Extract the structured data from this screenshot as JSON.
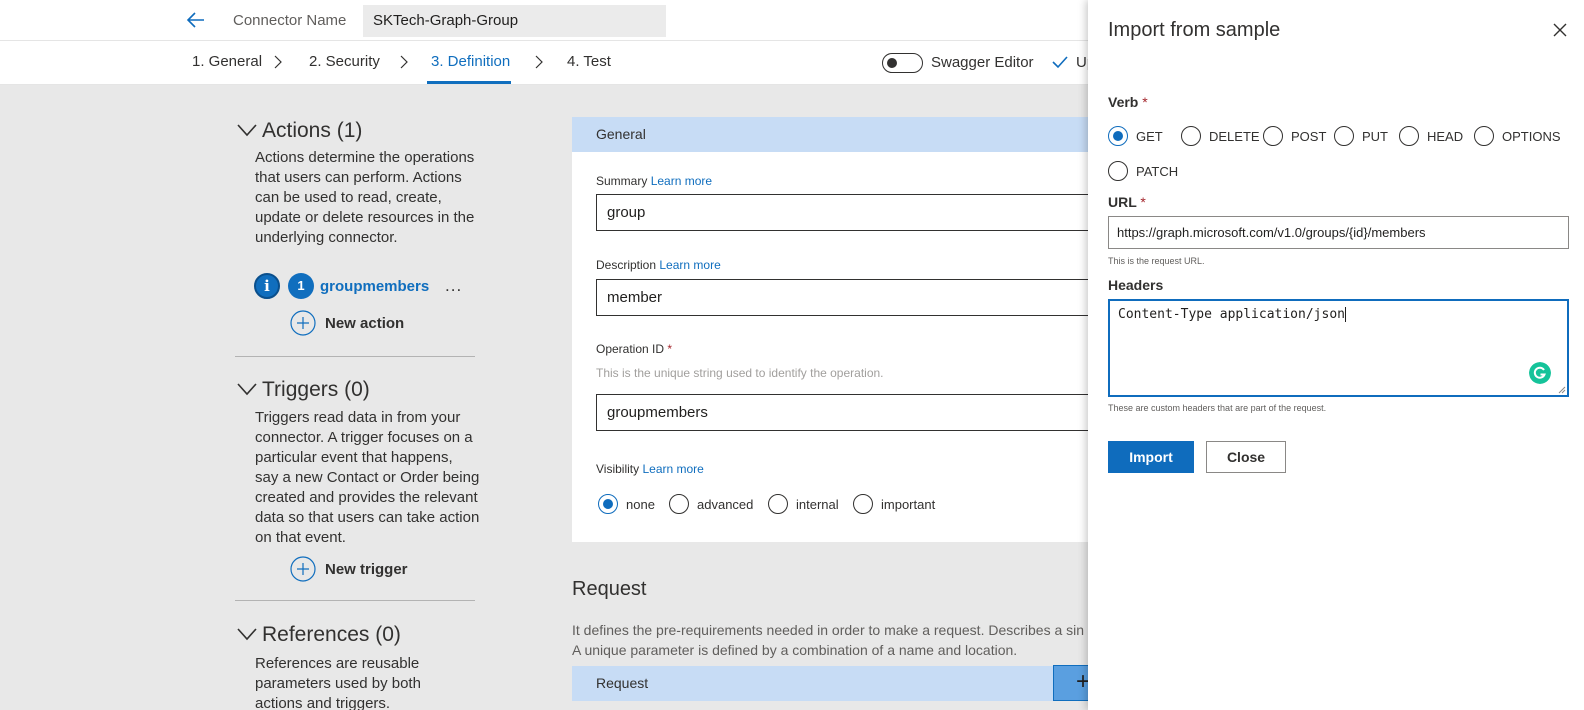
{
  "header": {
    "connector_label": "Connector Name",
    "connector_value": "SKTech-Graph-Group"
  },
  "steps": [
    {
      "label": "1. General"
    },
    {
      "label": "2. Security"
    },
    {
      "label": "3. Definition",
      "active": true
    },
    {
      "label": "4. Test"
    }
  ],
  "toolbar": {
    "swagger_label": "Swagger Editor",
    "swagger_on": false,
    "update_label": "Up"
  },
  "sidebar": {
    "actions": {
      "title": "Actions (1)",
      "desc": "Actions determine the operations that users can perform. Actions can be used to read, create, update or delete resources in the underlying connector.",
      "badge": "1",
      "item": "groupmembers",
      "more": "...",
      "new_label": "New action"
    },
    "triggers": {
      "title": "Triggers (0)",
      "desc": "Triggers read data in from your connector. A trigger focuses on a particular event that happens, say a new Contact or Order being created and provides the relevant data so that users can take action on that event.",
      "new_label": "New trigger"
    },
    "references": {
      "title": "References (0)",
      "desc": "References are reusable parameters used by both actions and triggers."
    }
  },
  "general_card": {
    "title": "General",
    "summary_label": "Summary",
    "summary_link": "Learn more",
    "summary_value": "group",
    "description_label": "Description",
    "description_link": "Learn more",
    "description_value": "member",
    "opid_label": "Operation ID",
    "opid_req": "*",
    "opid_hint": "This is the unique string used to identify the operation.",
    "opid_value": "groupmembers",
    "visibility_label": "Visibility",
    "visibility_link": "Learn more",
    "visibility_options": [
      "none",
      "advanced",
      "internal",
      "important"
    ],
    "visibility_selected": "none"
  },
  "request": {
    "title": "Request",
    "desc1": "It defines the pre-requirements needed in order to make a request. Describes a sin",
    "desc2": "A unique parameter is defined by a combination of a name and location.",
    "card_title": "Request",
    "add_symbol": "+"
  },
  "panel": {
    "title": "Import from sample",
    "verb_label": "Verb",
    "req": "*",
    "verbs": [
      "GET",
      "DELETE",
      "POST",
      "PUT",
      "HEAD",
      "OPTIONS",
      "PATCH"
    ],
    "verb_selected": "GET",
    "url_label": "URL",
    "url_value": "https://graph.microsoft.com/v1.0/groups/{id}/members",
    "url_hint": "This is the request URL.",
    "headers_label": "Headers",
    "headers_value": "Content-Type application/json",
    "headers_hint": "These are custom headers that are part of the request.",
    "import_label": "Import",
    "close_label": "Close"
  },
  "colors": {
    "accent": "#0f6cbd",
    "card_header": "#c7dcf5",
    "background": "#e8e8e8"
  }
}
